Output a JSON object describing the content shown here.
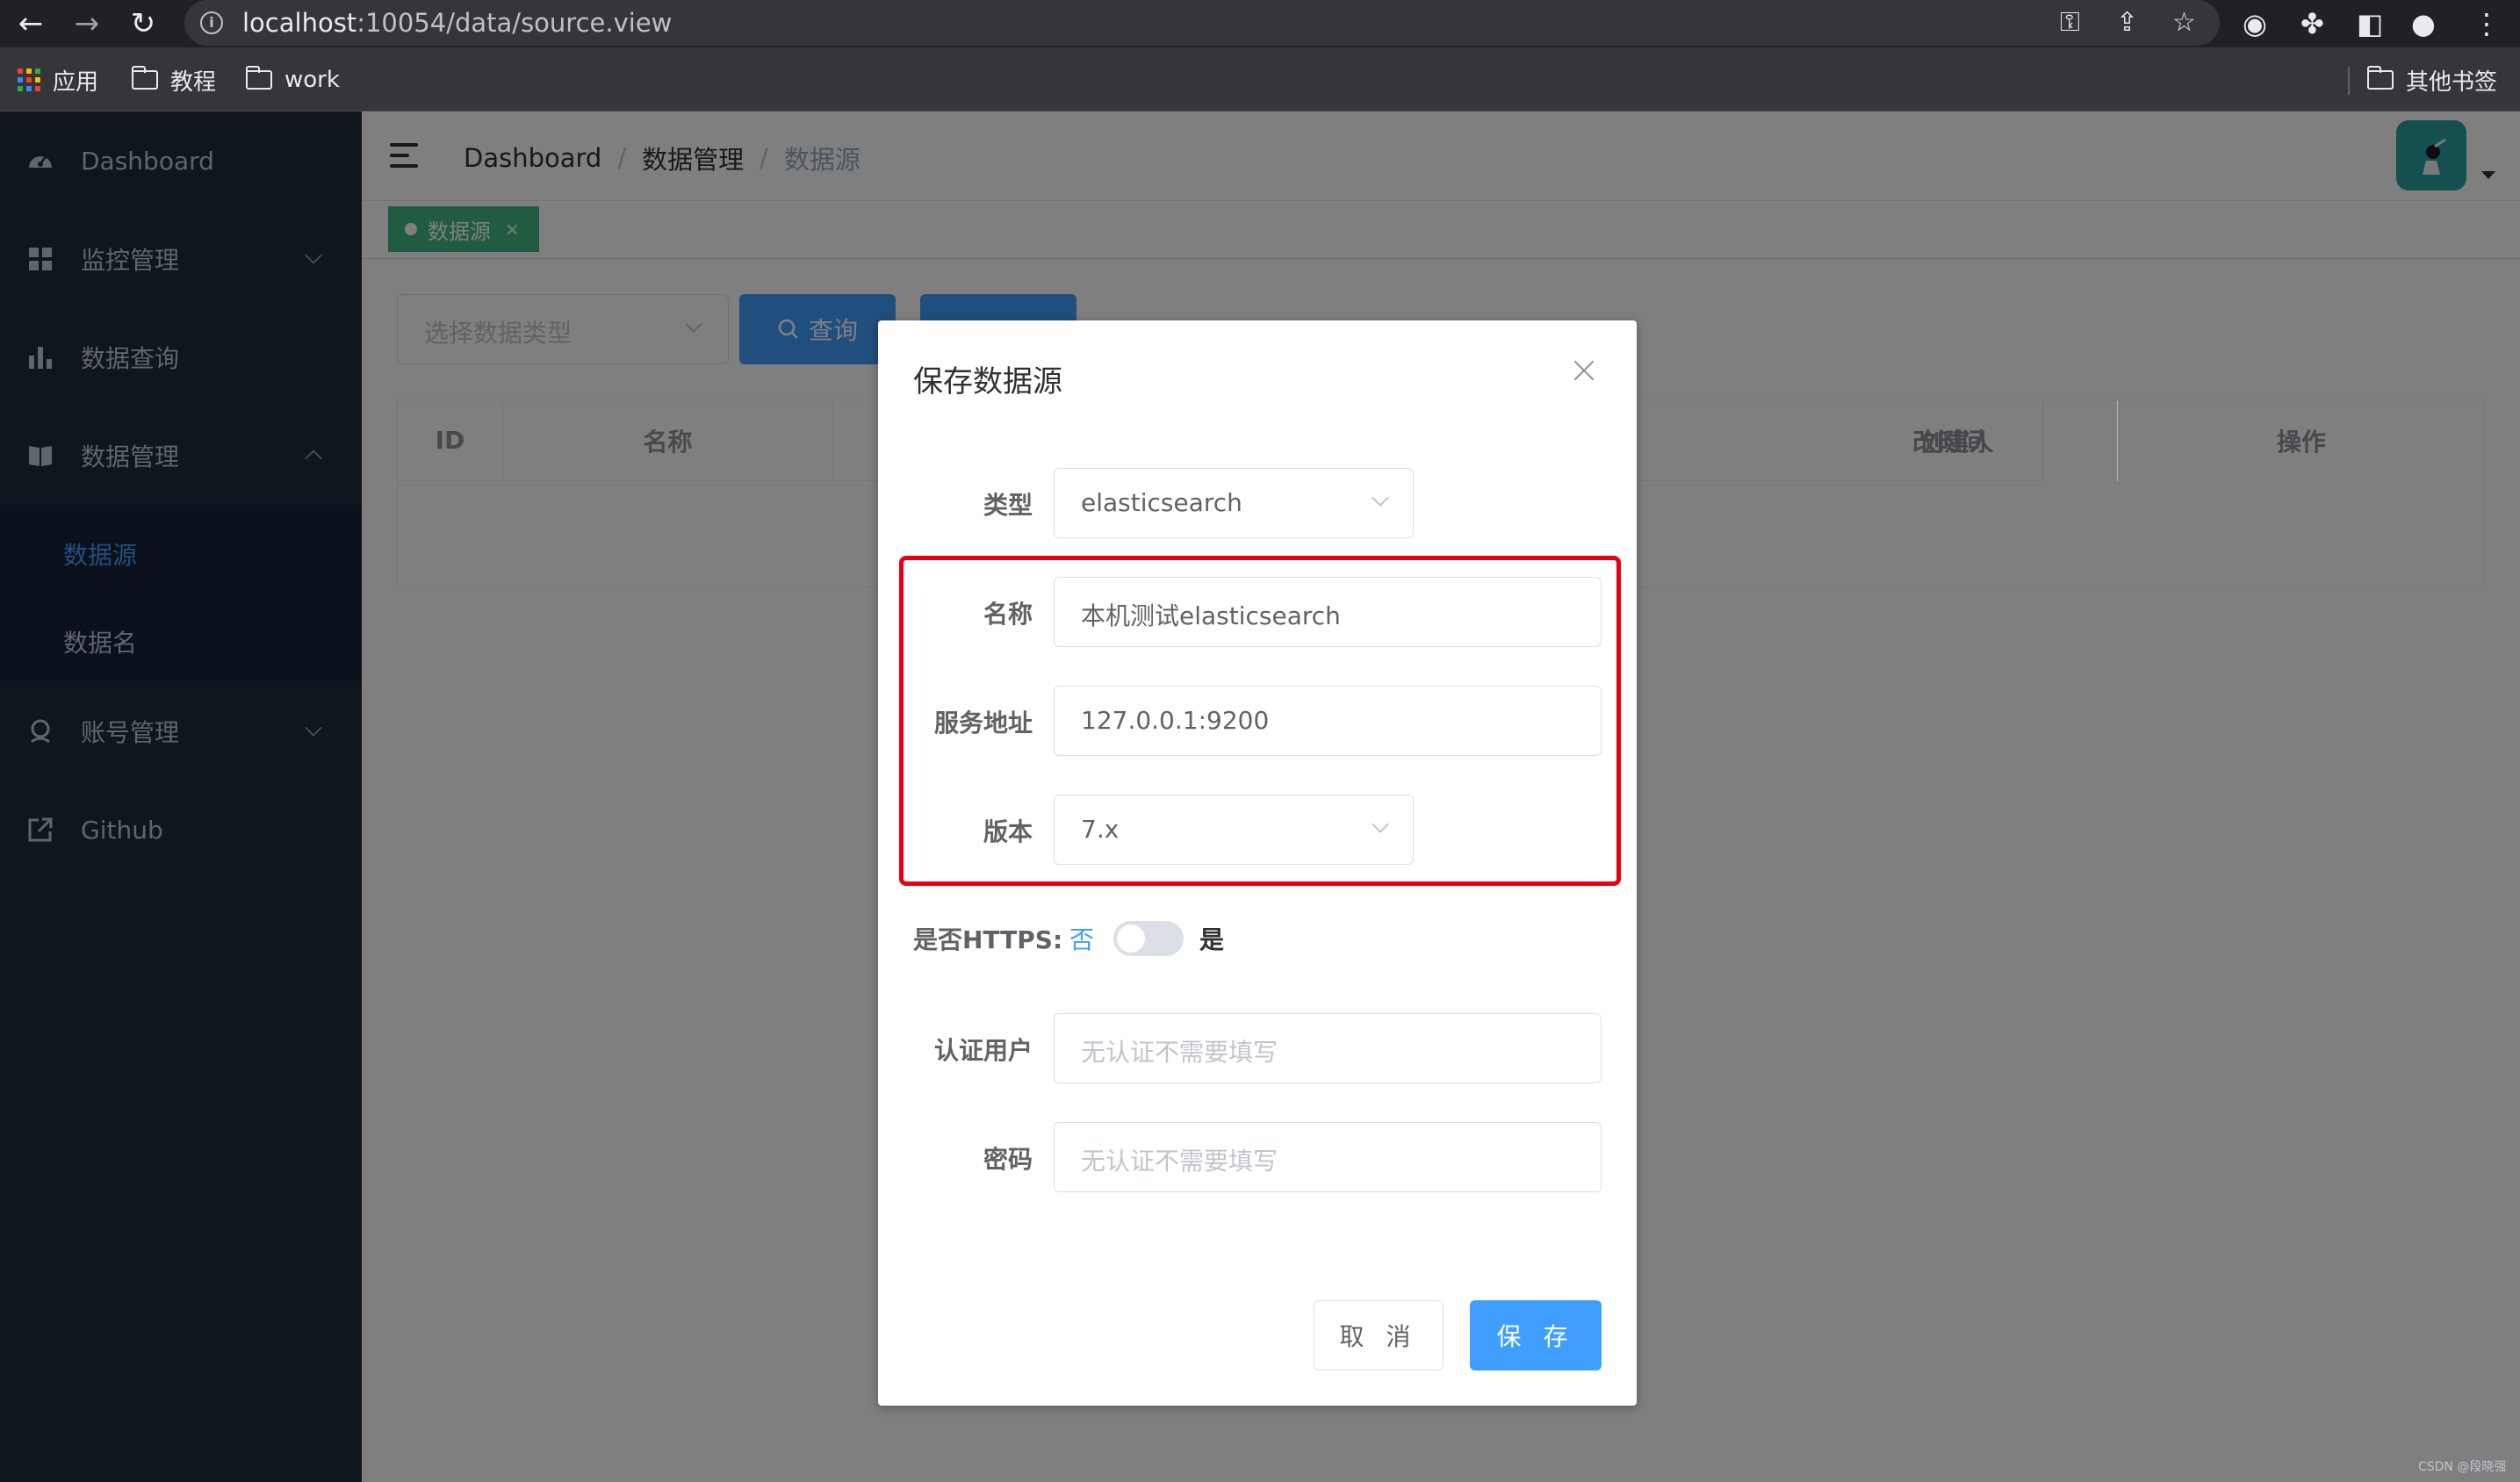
{
  "browser": {
    "url_host": "localhost",
    "url_rest": ":10054/data/source.view",
    "bookmarks": [
      {
        "label": "应用"
      },
      {
        "label": "教程"
      },
      {
        "label": "work"
      }
    ],
    "other_bookmarks": "其他书签"
  },
  "sidebar": {
    "items": [
      {
        "label": "Dashboard",
        "icon": "dashboard-icon"
      },
      {
        "label": "监控管理",
        "icon": "grid-icon"
      },
      {
        "label": "数据查询",
        "icon": "bar-chart-icon"
      },
      {
        "label": "数据管理",
        "icon": "book-icon"
      },
      {
        "label": "账号管理",
        "icon": "user-icon"
      },
      {
        "label": "Github",
        "icon": "external-link-icon"
      }
    ],
    "sub_items": [
      {
        "label": "数据源",
        "active": true
      },
      {
        "label": "数据名",
        "active": false
      }
    ]
  },
  "header": {
    "breadcrumb": [
      "Dashboard",
      "数据管理",
      "数据源"
    ],
    "breadcrumb_sep": "/"
  },
  "tags": {
    "active_tag": "数据源",
    "close": "×"
  },
  "toolbar": {
    "type_placeholder": "选择数据类型",
    "query_label": "查询"
  },
  "table": {
    "columns": [
      "ID",
      "名称",
      "改时间",
      "创建人",
      "操作"
    ]
  },
  "dialog": {
    "title": "保存数据源",
    "fields": {
      "type": {
        "label": "类型",
        "value": "elasticsearch"
      },
      "name": {
        "label": "名称",
        "value": "本机测试elasticsearch"
      },
      "address": {
        "label": "服务地址",
        "value": "127.0.0.1:9200"
      },
      "version": {
        "label": "版本",
        "value": "7.x"
      },
      "auth_user": {
        "label": "认证用户",
        "placeholder": "无认证不需要填写"
      },
      "password": {
        "label": "密码",
        "placeholder": "无认证不需要填写"
      }
    },
    "https": {
      "label": "是否HTTPS:",
      "off_label": "否",
      "on_label": "是",
      "enabled": false
    },
    "cancel_label": "取 消",
    "save_label": "保 存"
  },
  "watermark": "CSDN @段晓强",
  "colors": {
    "primary": "#409eff",
    "sidebar_bg": "#1f2d3d",
    "tag_green": "#42b983",
    "highlight_red": "#e60012"
  }
}
